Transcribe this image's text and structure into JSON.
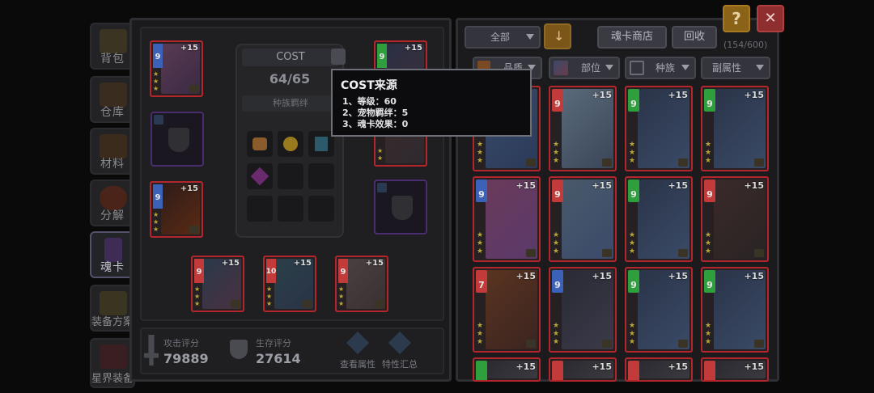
{
  "sidebar": {
    "items": [
      {
        "label": "背包",
        "icon": "backpack-icon"
      },
      {
        "label": "仓库",
        "icon": "chest-icon"
      },
      {
        "label": "材料",
        "icon": "materials-icon"
      },
      {
        "label": "分解",
        "icon": "decompose-icon"
      },
      {
        "label": "魂卡",
        "icon": "soul-card-icon",
        "active": true
      },
      {
        "label": "装备方案",
        "icon": "equipment-plan-icon"
      },
      {
        "label": "星界装备",
        "icon": "astral-equipment-icon"
      }
    ]
  },
  "cost_panel": {
    "title": "COST",
    "value": "64/65",
    "bond_label": "种族羁绊"
  },
  "equipped_cards": [
    {
      "level": "9",
      "plus": "+15",
      "color": "#3c62b8"
    },
    {
      "level": "9",
      "plus": "+15",
      "color": "#2f9e3c"
    },
    {
      "level": "9",
      "plus": "+15",
      "color": "#3c62b8"
    },
    {
      "level": "9",
      "plus": "+15",
      "color": "#c23a3a"
    },
    {
      "level": "10",
      "plus": "+15",
      "color": "#c23a3a"
    },
    {
      "level": "9",
      "plus": "+15",
      "color": "#c23a3a"
    }
  ],
  "stats": {
    "attack_label": "攻击评分",
    "attack_value": "79889",
    "survive_label": "生存评分",
    "survive_value": "27614",
    "view_attr_label": "查看属性",
    "trait_summary_label": "特性汇总"
  },
  "tooltip": {
    "title": "COST来源",
    "lines": [
      "1、等级：60",
      "2、宠物羁绊：5",
      "3、魂卡效果：0"
    ]
  },
  "toolbar": {
    "filter_all": "全部",
    "shop_label": "魂卡商店",
    "recycle_label": "回收",
    "count": "(154/600)",
    "help": "?",
    "close": "✕"
  },
  "filters": [
    "品质",
    "部位",
    "种族",
    "副属性"
  ],
  "card_list": [
    {
      "level": "",
      "plus": "",
      "color": "#c23a3a"
    },
    {
      "level": "9",
      "plus": "+15",
      "color": "#c23a3a"
    },
    {
      "level": "9",
      "plus": "+15",
      "color": "#2f9e3c"
    },
    {
      "level": "9",
      "plus": "+15",
      "color": "#2f9e3c"
    },
    {
      "level": "9",
      "plus": "+15",
      "color": "#3c62b8"
    },
    {
      "level": "9",
      "plus": "+15",
      "color": "#c23a3a"
    },
    {
      "level": "9",
      "plus": "+15",
      "color": "#2f9e3c"
    },
    {
      "level": "9",
      "plus": "+15",
      "color": "#c23a3a"
    },
    {
      "level": "7",
      "plus": "+15",
      "color": "#c23a3a"
    },
    {
      "level": "9",
      "plus": "+15",
      "color": "#3c62b8"
    },
    {
      "level": "9",
      "plus": "+15",
      "color": "#2f9e3c"
    },
    {
      "level": "9",
      "plus": "+15",
      "color": "#2f9e3c"
    },
    {
      "level": "",
      "plus": "+15",
      "color": "#2f9e3c"
    },
    {
      "level": "",
      "plus": "+15",
      "color": "#c23a3a"
    },
    {
      "level": "",
      "plus": "+15",
      "color": "#c23a3a"
    },
    {
      "level": "",
      "plus": "+15",
      "color": "#c23a3a"
    }
  ]
}
